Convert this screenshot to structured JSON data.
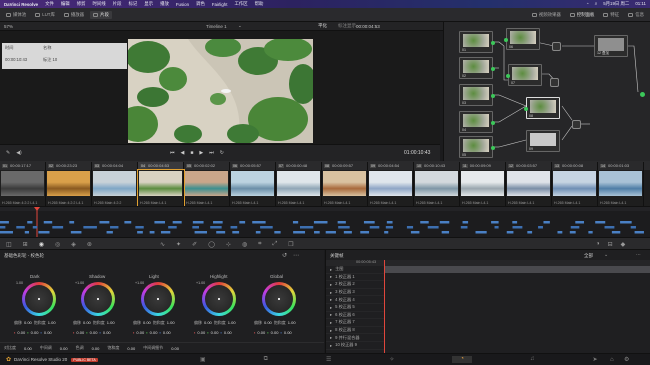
{
  "menubar": {
    "app": "DaVinci Resolve",
    "items": [
      "文件",
      "编辑",
      "修剪",
      "时间线",
      "片段",
      "标记",
      "显示",
      "播放",
      "Fusion",
      "调色",
      "Fairlight",
      "工作区",
      "帮助"
    ],
    "date": "5月19日 周二",
    "time": "01:11"
  },
  "toolbar": {
    "zoom": "57%",
    "left_buttons": [
      "媒体池",
      "LUT库",
      "播放器",
      "片段"
    ],
    "center_title": "Timeline 1",
    "center_label": "平化",
    "center_tab": "标注显示",
    "timecode": "00:00:04:53",
    "right_buttons": [
      "视频效果器",
      "控制面板",
      "特征",
      "信息"
    ],
    "right_label": "片段"
  },
  "clip_info": {
    "label_clip": "时间",
    "val_clip": "00:00:10:43",
    "label_name": "名称",
    "val_name": "标注 10"
  },
  "transport": {
    "timecode": "01:00:10:43"
  },
  "nodes": [
    {
      "num": "01"
    },
    {
      "num": "02"
    },
    {
      "num": "03"
    },
    {
      "num": "04"
    },
    {
      "num": "05"
    },
    {
      "num": "06"
    },
    {
      "num": "07"
    },
    {
      "num": "08"
    },
    {
      "num": "09"
    },
    {
      "num": "10"
    },
    {
      "num": "11"
    },
    {
      "num": "12 叠加"
    }
  ],
  "clips": [
    {
      "n": "01",
      "tc": "00:00:17:17",
      "cap": "H.265 Main 4:2:2 L4.1",
      "c1": "#3a3a3a",
      "c2": "#6a6a6a"
    },
    {
      "n": "02",
      "tc": "00:00:23:23",
      "cap": "H.265 Main 4:2:2 L4.1",
      "c1": "#8a5a20",
      "c2": "#d9a04a"
    },
    {
      "n": "03",
      "tc": "00:00:04:04",
      "cap": "H.265 Main 4:2:2",
      "c1": "#7ea6c6",
      "c2": "#c8d2d8"
    },
    {
      "n": "04",
      "tc": "00:00:04:53",
      "cap": "H.265 Main L4.1",
      "c1": "#5c8d3f",
      "c2": "#d9d2c2"
    },
    {
      "n": "05",
      "tc": "00:00:02:02",
      "cap": "H.265 Main L4.1",
      "c1": "#3c8f8f",
      "c2": "#c9a68a"
    },
    {
      "n": "06",
      "tc": "00:00:05:57",
      "cap": "H.265 Main L4.1",
      "c1": "#6b8fa8",
      "c2": "#bcd3e0"
    },
    {
      "n": "07",
      "tc": "00:00:00:48",
      "cap": "H.265 Main L4.1",
      "c1": "#8fa6b6",
      "c2": "#dfe6ea"
    },
    {
      "n": "08",
      "tc": "00:00:09:57",
      "cap": "H.265 Main L4.1",
      "c1": "#a86a3c",
      "c2": "#d9c2a0"
    },
    {
      "n": "09",
      "tc": "00:00:04:54",
      "cap": "H.265 Main L4.1",
      "c1": "#8fa6c6",
      "c2": "#e0e6ec"
    },
    {
      "n": "10",
      "tc": "00:00:10:43",
      "cap": "H.265 Main L4.1",
      "c1": "#7e96a6",
      "c2": "#d3d9dd"
    },
    {
      "n": "11",
      "tc": "00:00:09:09",
      "cap": "H.265 Main L4.1",
      "c1": "#9aa6ae",
      "c2": "#e6e9eb"
    },
    {
      "n": "12",
      "tc": "00:00:03:57",
      "cap": "H.265 Main L4.1",
      "c1": "#7a8ea6",
      "c2": "#dfe3e8"
    },
    {
      "n": "13",
      "tc": "00:00:00:08",
      "cap": "H.265 Main L4.1",
      "c1": "#6f8fb5",
      "c2": "#c6d4e2"
    },
    {
      "n": "14",
      "tc": "00:00:01:03",
      "cap": "H.265 Main L4.1",
      "c1": "#4f7ea6",
      "c2": "#a9c2d6"
    }
  ],
  "color_panel": {
    "title": "基础色彩轮 - 校色轮",
    "wheels": [
      {
        "name": "Dark",
        "top": "1.00",
        "r": "0.00",
        "g": "0.00",
        "b": "0.00",
        "l": "0.00"
      },
      {
        "name": "Shadow",
        "top": "+1.00",
        "r": "0.00",
        "g": "0.00",
        "b": "0.00",
        "l": "0.00"
      },
      {
        "name": "Light",
        "top": "+1.00",
        "r": "0.00",
        "g": "0.00",
        "b": "0.00",
        "l": "0.00"
      },
      {
        "name": "Highlight",
        "top": "+1.00",
        "r": "0.00",
        "g": "0.00",
        "b": "0.00",
        "l": "0.00"
      },
      {
        "name": "Global",
        "top": "",
        "r": "0.00",
        "g": "0.00",
        "b": "0.00",
        "l": "0.00"
      }
    ],
    "row_a_labels": [
      "偏移",
      "0.00",
      "饱和度",
      "1.00"
    ],
    "row_b_values": [
      "0.00",
      "0.00",
      "0.00"
    ],
    "bottom_labels": [
      "对比度",
      "0.00",
      "中间调",
      "0.00",
      "色调",
      "0.00",
      "饱和度",
      "0.00",
      "中间调细节",
      "0.00"
    ]
  },
  "keyframes": {
    "title": "关键帧",
    "filter": "全部",
    "tc": "00:00:05:43",
    "rows": [
      "主图",
      "1 校正器 1",
      "2 校正器 2",
      "3 校正器 3",
      "4 校正器 4",
      "5 校正器 5",
      "6 校正器 6",
      "7 校正器 7",
      "8 校正器 8",
      "9 并行混合器",
      "10 校正器 9"
    ]
  },
  "statusbar": {
    "app": "DaVinci Resolve Studio 20",
    "badge": "PUBLIC BETA"
  }
}
